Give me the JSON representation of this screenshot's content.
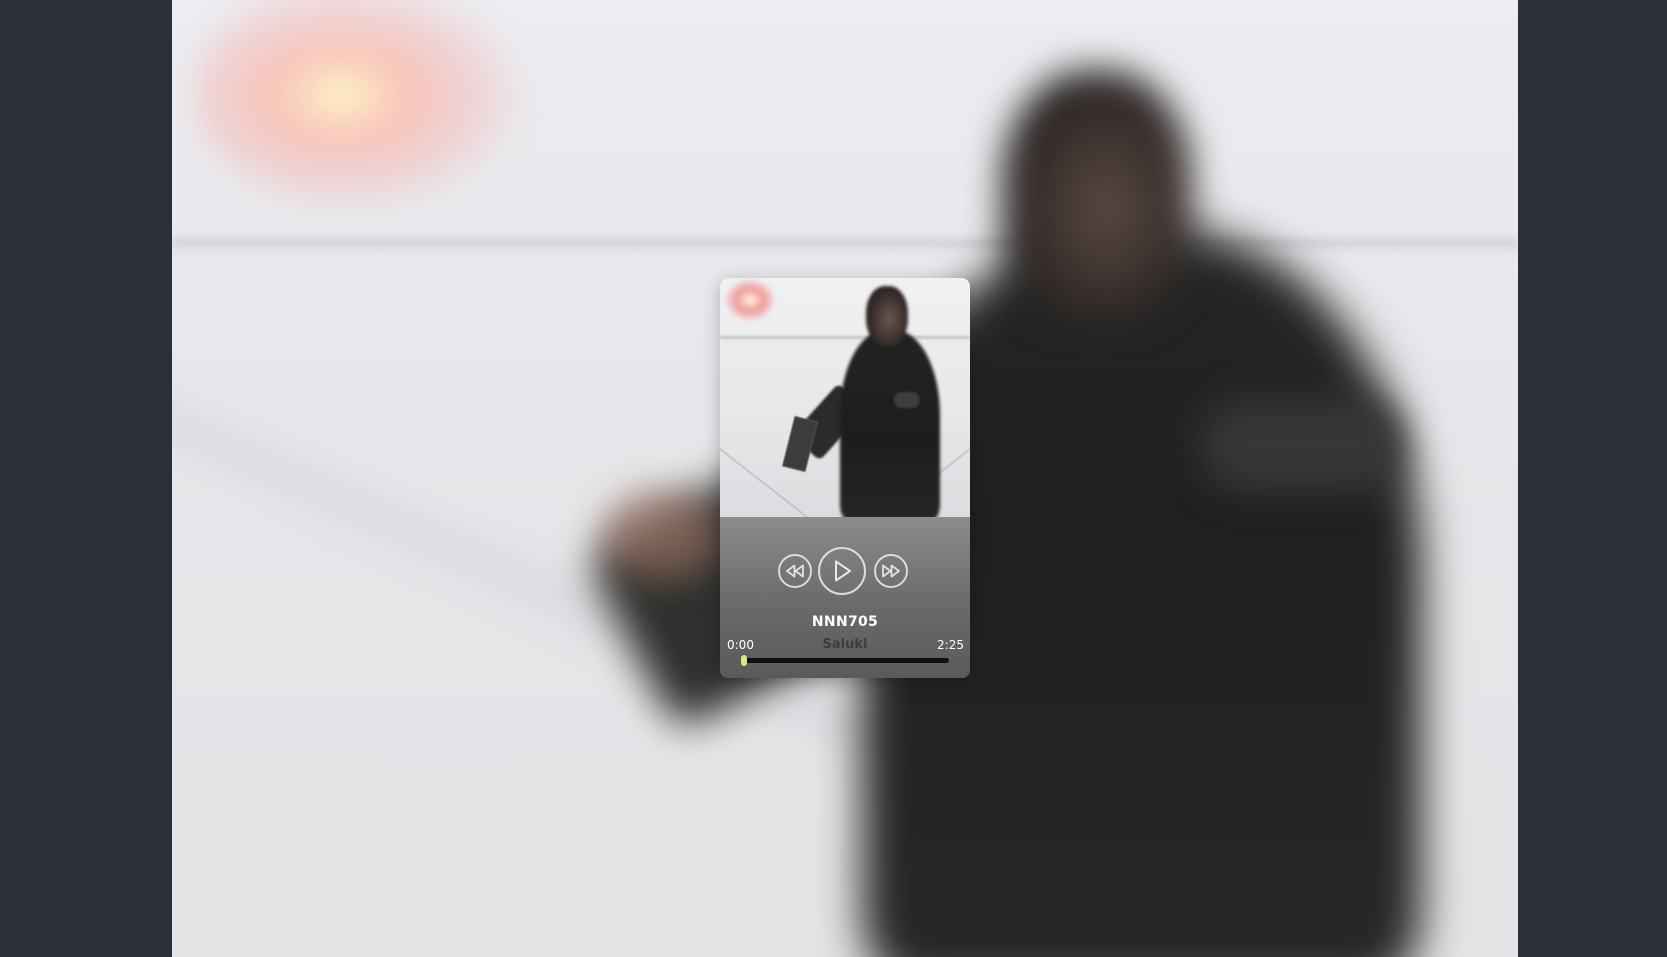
{
  "player": {
    "track_title": "NNN705",
    "artist": "Saluki",
    "time_current": "0:00",
    "time_total": "2:25",
    "progress": 0.0,
    "accent_color": "#d4ec7a",
    "controls": {
      "prev_icon": "rewind-icon",
      "play_icon": "play-icon",
      "next_icon": "fast-forward-icon"
    }
  }
}
